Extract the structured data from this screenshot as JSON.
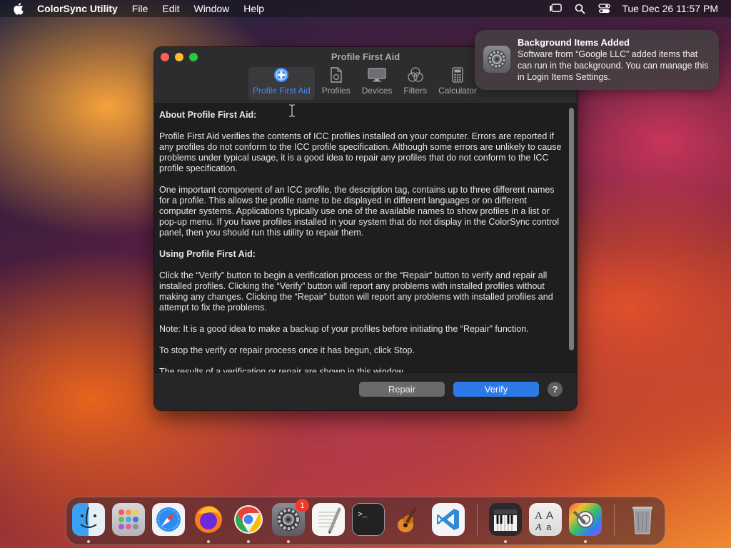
{
  "menubar": {
    "app_name": "ColorSync Utility",
    "menus": [
      "File",
      "Edit",
      "Window",
      "Help"
    ],
    "clock": "Tue Dec 26  11:57 PM"
  },
  "notification": {
    "title": "Background Items Added",
    "body": "Software from “Google LLC” added items that can run in the background. You can manage this in Login Items Settings."
  },
  "window": {
    "title": "Profile First Aid",
    "toolbar": [
      {
        "label": "Profile First Aid",
        "icon": "plus-circle-icon",
        "active": true
      },
      {
        "label": "Profiles",
        "icon": "document-icon",
        "active": false
      },
      {
        "label": "Devices",
        "icon": "monitor-icon",
        "active": false
      },
      {
        "label": "Filters",
        "icon": "filters-icon",
        "active": false
      },
      {
        "label": "Calculator",
        "icon": "calculator-icon",
        "active": false
      }
    ],
    "content": {
      "about_heading": "About Profile First Aid:",
      "para1": "Profile First Aid verifies the contents of ICC profiles installed on your computer. Errors are reported if any profiles do not conform to the ICC profile specification. Although some errors are unlikely to cause problems under typical usage, it is a good idea to repair any profiles that do not conform to the ICC profile specification.",
      "para2": "One important component of an ICC profile, the description tag, contains up to three different names for a profile. This allows the profile name to be displayed in different languages or on different computer systems. Applications typically use one of the available names to show profiles in a list or pop-up menu. If you have profiles installed in your system that do not display in the ColorSync control panel, then you should run this utility to repair them.",
      "using_heading": "Using Profile First Aid:",
      "para3": "Click the “Verify” button to begin a verification process or the “Repair” button to verify and repair all installed profiles. Clicking the “Verify” button will report any problems with installed profiles without making any changes. Clicking the “Repair” button will report any problems with installed profiles and attempt to fix the problems.",
      "para4": "Note: It is a good idea to make a backup of your profiles before initiating the “Repair” function.",
      "para5": "To stop the verify or repair process once it has begun, click Stop.",
      "para6": "The results of a verification or repair are shown in this window."
    },
    "buttons": {
      "repair": "Repair",
      "verify": "Verify",
      "help": "?"
    }
  },
  "dock": {
    "system_settings_badge": "1",
    "items": [
      "finder-icon",
      "launchpad-icon",
      "safari-icon",
      "firefox-icon",
      "chrome-icon",
      "system-settings-icon",
      "textedit-icon",
      "terminal-icon",
      "garageband-icon",
      "vscode-icon",
      "piano-icon",
      "font-book-icon",
      "colorsync-icon",
      "trash-icon"
    ]
  },
  "colors": {
    "accent": "#2d79e6",
    "active_tab": "#3e8ef7",
    "window_bg": "#1e1e1e"
  }
}
